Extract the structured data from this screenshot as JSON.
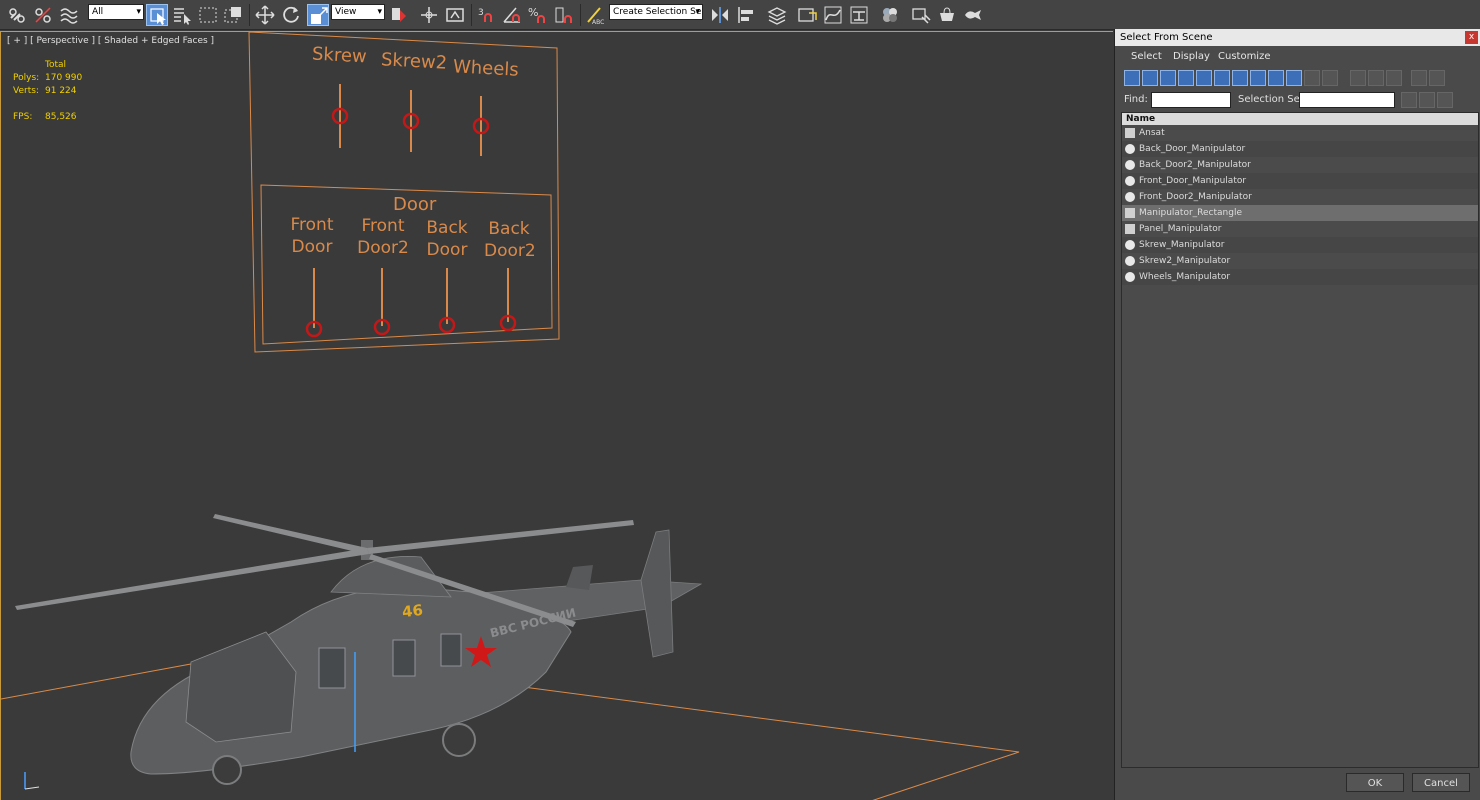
{
  "toolbar": {
    "filter_dropdown": "All",
    "refcoord_dropdown": "View",
    "selection_set_dropdown": "Create Selection Se",
    "icons": [
      "link-icon",
      "unlink-icon",
      "bind-spacewarp-icon",
      "select-object-icon",
      "select-by-name-icon",
      "rect-region-icon",
      "window-crossing-icon",
      "move-icon",
      "rotate-icon",
      "scale-icon",
      "select-manipulate-icon",
      "keyboard-shortcut-icon",
      "snap-icon",
      "angle-snap-icon",
      "percent-snap-icon",
      "spinner-snap-icon",
      "edit-named-sel-icon",
      "mirror-icon",
      "align-icon",
      "layer-manager-icon",
      "scene-explorer-icon",
      "curve-editor-icon",
      "schematic-view-icon",
      "material-editor-icon",
      "render-setup-icon",
      "rendered-frame-icon",
      "render-icon"
    ]
  },
  "viewport": {
    "label": "[ + ] [ Perspective ] [ Shaded + Edged Faces ]",
    "stats": {
      "total_label": "Total",
      "polys_label": "Polys:",
      "polys_value": "170 990",
      "verts_label": "Verts:",
      "verts_value": "91 224",
      "fps_label": "FPS:",
      "fps_value": "85,526"
    },
    "manipulators": {
      "top_labels": [
        "Skrew",
        "Skrew2",
        "Wheels"
      ],
      "door_title": "Door",
      "door_labels": [
        [
          "Front",
          "Door"
        ],
        [
          "Front",
          "Door2"
        ],
        [
          "Back",
          "Door"
        ],
        [
          "Back",
          "Door2"
        ]
      ]
    },
    "helicopter_number": "46",
    "helicopter_text": "ВВС РОССИИ"
  },
  "panel": {
    "title": "Select From Scene",
    "close_label": "x",
    "menu": [
      "Select",
      "Display",
      "Customize"
    ],
    "find_label": "Find:",
    "selection_set_label": "Selection Set:",
    "list_header": "Name",
    "items": [
      {
        "name": "Ansat",
        "type": "object"
      },
      {
        "name": "Back_Door_Manipulator",
        "type": "helper"
      },
      {
        "name": "Back_Door2_Manipulator",
        "type": "helper"
      },
      {
        "name": "Front_Door_Manipulator",
        "type": "helper"
      },
      {
        "name": "Front_Door2_Manipulator",
        "type": "helper"
      },
      {
        "name": "Manipulator_Rectangle",
        "type": "object",
        "selected": true
      },
      {
        "name": "Panel_Manipulator",
        "type": "object"
      },
      {
        "name": "Skrew_Manipulator",
        "type": "helper"
      },
      {
        "name": "Skrew2_Manipulator",
        "type": "helper"
      },
      {
        "name": "Wheels_Manipulator",
        "type": "helper"
      }
    ],
    "ok_label": "OK",
    "cancel_label": "Cancel"
  },
  "colors": {
    "viewport_bg": "#3a3a3a",
    "manipulator_orange": "#d98a4a",
    "slider_red": "#c41818",
    "stats_yellow": "#f0d000"
  }
}
